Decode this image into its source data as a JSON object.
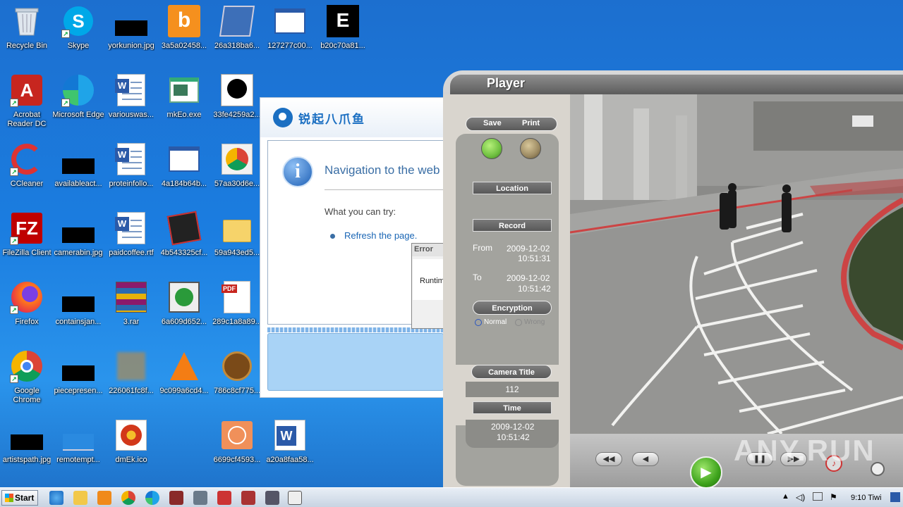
{
  "desktop": {
    "icons": [
      {
        "label": "Recycle Bin"
      },
      {
        "label": "Skype"
      },
      {
        "label": "yorkunion.jpg"
      },
      {
        "label": "3a5a02458..."
      },
      {
        "label": "26a318ba6..."
      },
      {
        "label": "127277c00..."
      },
      {
        "label": "b20c70a81..."
      },
      {
        "label": "Acrobat Reader DC"
      },
      {
        "label": "Microsoft Edge"
      },
      {
        "label": "variouswas..."
      },
      {
        "label": "mkEo.exe"
      },
      {
        "label": "33fe4259a2..."
      },
      {
        "label": "CCleaner"
      },
      {
        "label": "availableact..."
      },
      {
        "label": "proteinfollo..."
      },
      {
        "label": "4a184b64b..."
      },
      {
        "label": "57aa30d6e..."
      },
      {
        "label": "FileZilla Client"
      },
      {
        "label": "camerabin.jpg"
      },
      {
        "label": "paidcoffee.rtf"
      },
      {
        "label": "4b543325cf..."
      },
      {
        "label": "59a943ed5..."
      },
      {
        "label": "Firefox"
      },
      {
        "label": "containsjan..."
      },
      {
        "label": "3.rar"
      },
      {
        "label": "6a609d652..."
      },
      {
        "label": "289c1a8a89..."
      },
      {
        "label": "Google Chrome"
      },
      {
        "label": "piecepresen..."
      },
      {
        "label": "226061fc8f..."
      },
      {
        "label": "9c099a6cd4..."
      },
      {
        "label": "786c8cf775..."
      },
      {
        "label": "artistspath.jpg"
      },
      {
        "label": "remotempt..."
      },
      {
        "label": "dmEk.ico"
      },
      {
        "label": "6699cf4593..."
      },
      {
        "label": "a20a8faa58..."
      }
    ]
  },
  "browser": {
    "brand": "锐起八爪鱼",
    "title": "Navigation to the web",
    "try_label": "What you can try:",
    "refresh_link": "Refresh the page."
  },
  "error_dialog": {
    "title": "Error",
    "message": "Runtim"
  },
  "player": {
    "title": "Player",
    "save": "Save",
    "print": "Print",
    "location": "Location",
    "record": "Record",
    "from_label": "From",
    "from_date": "2009-12-02",
    "from_time": "10:51:31",
    "to_label": "To",
    "to_date": "2009-12-02",
    "to_time": "10:51:42",
    "encryption": "Encryption",
    "normal": "Normal",
    "wrong": "Wrong",
    "camera_title_label": "Camera Title",
    "camera_title_value": "112",
    "time_label": "Time",
    "time_date": "2009-12-02",
    "time_time": "10:51:42"
  },
  "watermark": "ANY.RUN",
  "taskbar": {
    "start": "Start",
    "clock": "9:10 Tiwi"
  },
  "colors": {
    "desktop": "#1b7de0",
    "save_button": "#6fc040",
    "print_button": "#9c8a62"
  }
}
